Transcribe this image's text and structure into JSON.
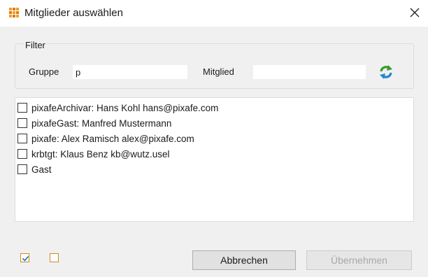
{
  "window": {
    "title": "Mitglieder auswählen",
    "icon": "grid-app-icon",
    "close_icon": "close-icon"
  },
  "filter": {
    "legend": "Filter",
    "group_label": "Gruppe",
    "group_value": "p",
    "member_label": "Mitglied",
    "member_value": "",
    "refresh_icon": "refresh-icon"
  },
  "members": [
    {
      "label": "pixafeArchivar: Hans Kohl hans@pixafe.com",
      "checked": false
    },
    {
      "label": "pixafeGast: Manfred Mustermann",
      "checked": false
    },
    {
      "label": "pixafe: Alex Ramisch alex@pixafe.com",
      "checked": false
    },
    {
      "label": "krbtgt: Klaus Benz kb@wutz.usel",
      "checked": false
    },
    {
      "label": "Gast",
      "checked": false
    }
  ],
  "footer": {
    "select_all_icon": "check-all-icon",
    "select_none_icon": "uncheck-all-icon",
    "cancel_label": "Abbrechen",
    "apply_label": "Übernehmen",
    "apply_enabled": false
  },
  "colors": {
    "accent": "#f0a020",
    "refresh_green": "#3a9a2a",
    "refresh_blue": "#1e88d8"
  }
}
